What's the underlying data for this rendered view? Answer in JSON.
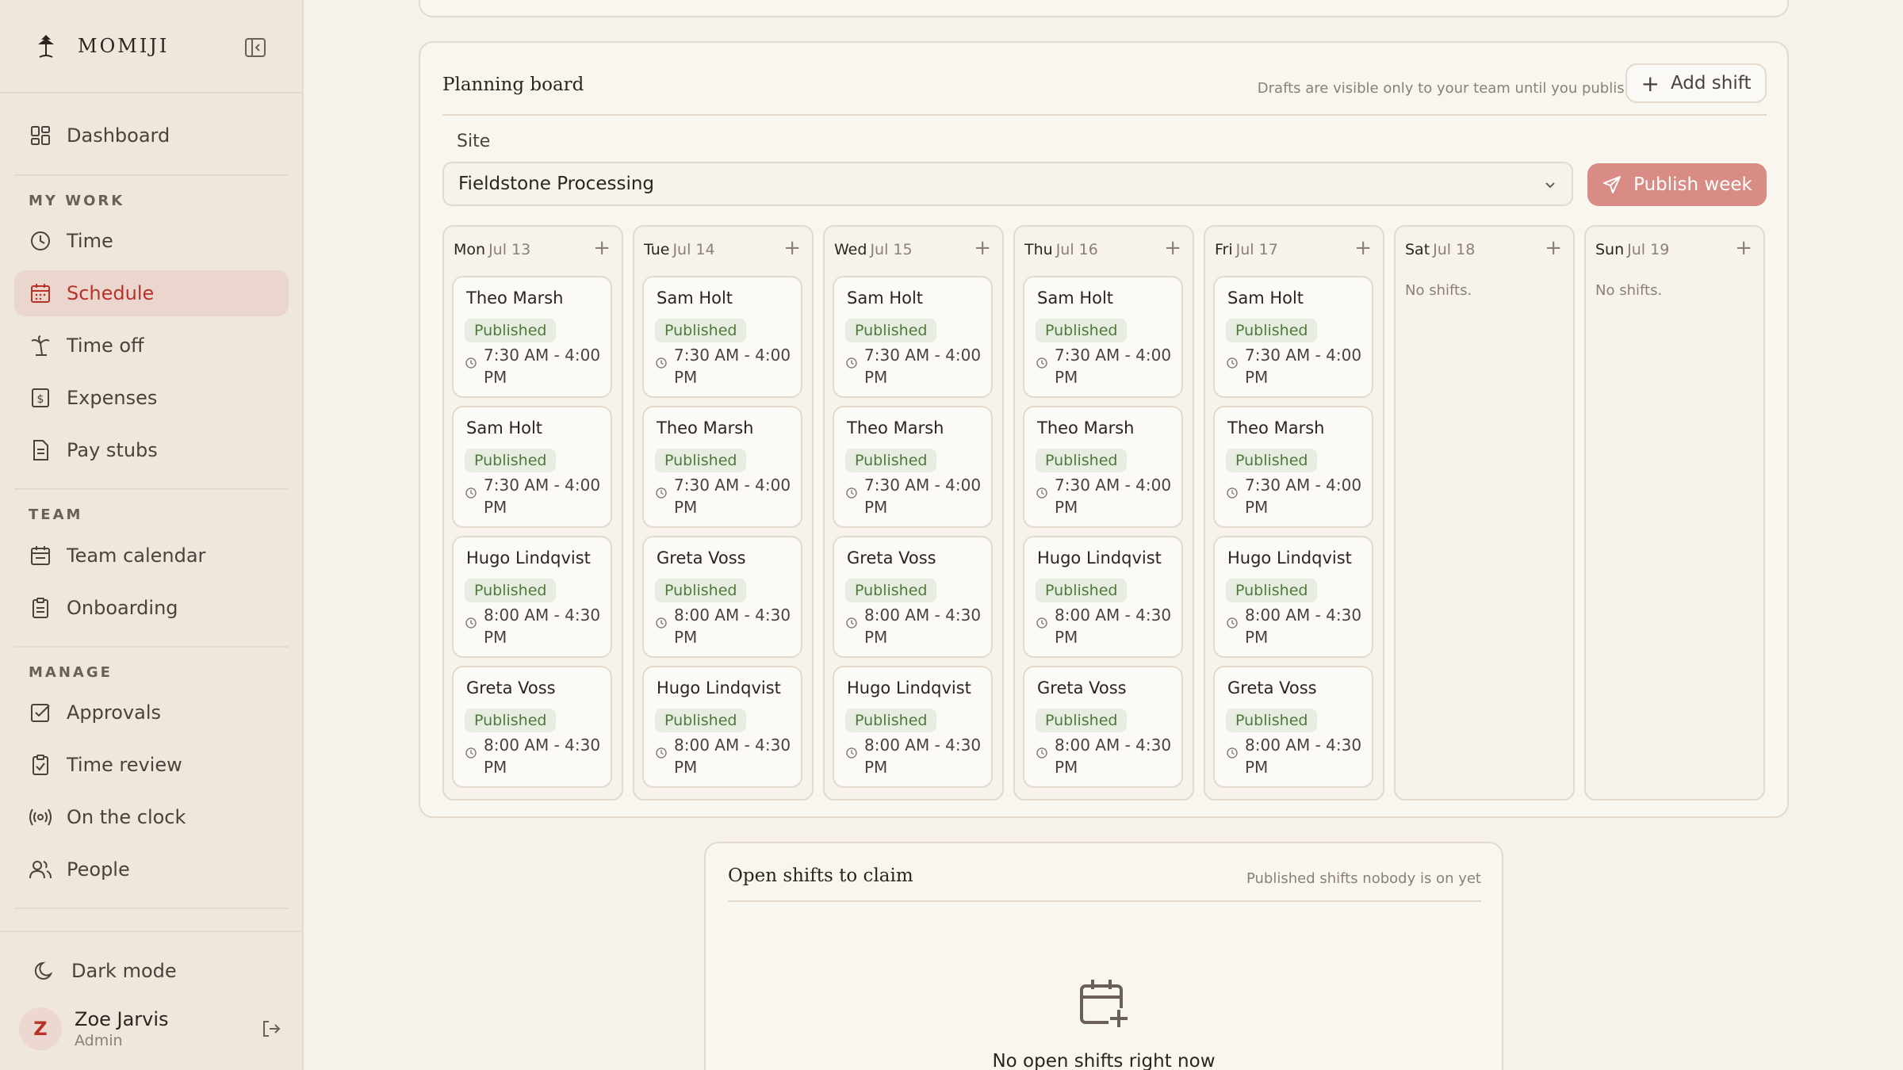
{
  "brand": {
    "name": "MOMIJI"
  },
  "nav": {
    "dashboard": "Dashboard",
    "sections": [
      {
        "label": "MY WORK",
        "items": [
          "Time",
          "Schedule",
          "Time off",
          "Expenses",
          "Pay stubs"
        ]
      },
      {
        "label": "TEAM",
        "items": [
          "Team calendar",
          "Onboarding"
        ]
      },
      {
        "label": "MANAGE",
        "items": [
          "Approvals",
          "Time review",
          "On the clock",
          "People"
        ]
      }
    ],
    "active": "Schedule",
    "dark_mode": "Dark mode"
  },
  "user": {
    "initial": "Z",
    "name": "Zoe Jarvis",
    "role": "Admin"
  },
  "board": {
    "title": "Planning board",
    "hint": "Drafts are visible only to your team until you publish",
    "add_shift": "Add shift",
    "site_label": "Site",
    "site_value": "Fieldstone Processing",
    "publish": "Publish week",
    "days": [
      {
        "day": "Mon",
        "date": "Jul 13",
        "shifts": [
          {
            "name": "Theo Marsh",
            "status": "Published",
            "time": "7:30 AM - 4:00 PM"
          },
          {
            "name": "Sam Holt",
            "status": "Published",
            "time": "7:30 AM - 4:00 PM"
          },
          {
            "name": "Hugo Lindqvist",
            "status": "Published",
            "time": "8:00 AM - 4:30 PM"
          },
          {
            "name": "Greta Voss",
            "status": "Published",
            "time": "8:00 AM - 4:30 PM"
          }
        ]
      },
      {
        "day": "Tue",
        "date": "Jul 14",
        "shifts": [
          {
            "name": "Sam Holt",
            "status": "Published",
            "time": "7:30 AM - 4:00 PM"
          },
          {
            "name": "Theo Marsh",
            "status": "Published",
            "time": "7:30 AM - 4:00 PM"
          },
          {
            "name": "Greta Voss",
            "status": "Published",
            "time": "8:00 AM - 4:30 PM"
          },
          {
            "name": "Hugo Lindqvist",
            "status": "Published",
            "time": "8:00 AM - 4:30 PM"
          }
        ]
      },
      {
        "day": "Wed",
        "date": "Jul 15",
        "shifts": [
          {
            "name": "Sam Holt",
            "status": "Published",
            "time": "7:30 AM - 4:00 PM"
          },
          {
            "name": "Theo Marsh",
            "status": "Published",
            "time": "7:30 AM - 4:00 PM"
          },
          {
            "name": "Greta Voss",
            "status": "Published",
            "time": "8:00 AM - 4:30 PM"
          },
          {
            "name": "Hugo Lindqvist",
            "status": "Published",
            "time": "8:00 AM - 4:30 PM"
          }
        ]
      },
      {
        "day": "Thu",
        "date": "Jul 16",
        "shifts": [
          {
            "name": "Sam Holt",
            "status": "Published",
            "time": "7:30 AM - 4:00 PM"
          },
          {
            "name": "Theo Marsh",
            "status": "Published",
            "time": "7:30 AM - 4:00 PM"
          },
          {
            "name": "Hugo Lindqvist",
            "status": "Published",
            "time": "8:00 AM - 4:30 PM"
          },
          {
            "name": "Greta Voss",
            "status": "Published",
            "time": "8:00 AM - 4:30 PM"
          }
        ]
      },
      {
        "day": "Fri",
        "date": "Jul 17",
        "shifts": [
          {
            "name": "Sam Holt",
            "status": "Published",
            "time": "7:30 AM - 4:00 PM"
          },
          {
            "name": "Theo Marsh",
            "status": "Published",
            "time": "7:30 AM - 4:00 PM"
          },
          {
            "name": "Hugo Lindqvist",
            "status": "Published",
            "time": "8:00 AM - 4:30 PM"
          },
          {
            "name": "Greta Voss",
            "status": "Published",
            "time": "8:00 AM - 4:30 PM"
          }
        ]
      },
      {
        "day": "Sat",
        "date": "Jul 18",
        "shifts": []
      },
      {
        "day": "Sun",
        "date": "Jul 19",
        "shifts": []
      }
    ],
    "no_shifts": "No shifts."
  },
  "open_shifts": {
    "title": "Open shifts to claim",
    "hint": "Published shifts nobody is on yet",
    "empty": "No open shifts right now"
  },
  "colors": {
    "accent": "#b8322a",
    "publish_bg": "#d98b86",
    "badge_bg": "#e7ede0",
    "badge_text": "#4f7a3a"
  }
}
